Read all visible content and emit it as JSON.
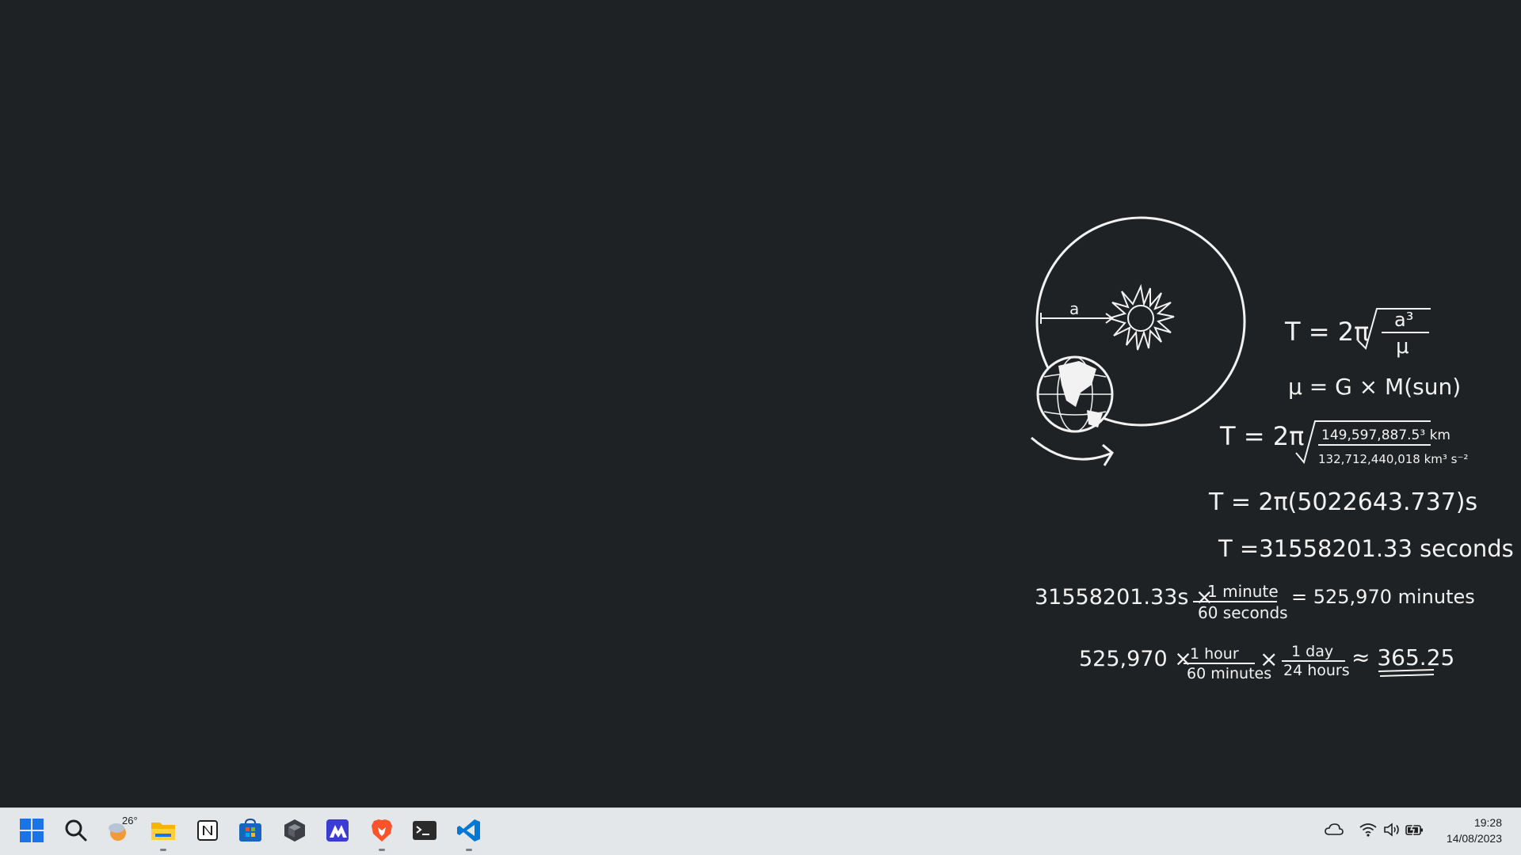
{
  "wallpaper": {
    "diagram_label": "a",
    "equations": {
      "eq1_lhs": "T = 2π",
      "eq1_num": "a³",
      "eq1_den": "μ",
      "eq2": "μ = G × M(sun)",
      "eq3_lhs": "T = 2π",
      "eq3_num": "149,597,887.5³ km",
      "eq3_den": "132,712,440,018 km³ s⁻²",
      "eq4": "T = 2π(5022643.737)s",
      "eq5": "T =31558201.33 seconds",
      "eq6_lhs": "31558201.33s ×",
      "eq6_num": "1 minute",
      "eq6_den": "60 seconds",
      "eq6_rhs": "= 525,970 minutes",
      "eq7_lhs": "525,970 ×",
      "eq7_num1": "1 hour",
      "eq7_den1": "60 minutes",
      "eq7_mid": "×",
      "eq7_num2": "1 day",
      "eq7_den2": "24 hours",
      "eq7_rhs": "≈ 365.25"
    }
  },
  "taskbar": {
    "weather_temp": "26°",
    "apps": [
      "start",
      "search",
      "weather",
      "file-explorer",
      "notion",
      "microsoft-store",
      "unity",
      "affinity",
      "brave",
      "terminal",
      "vscode"
    ]
  },
  "clock": {
    "time": "19:28",
    "date": "14/08/2023"
  },
  "colors": {
    "desktop_bg": "#1f2224",
    "taskbar_bg": "#e3e7ea",
    "chalk": "#f2f2f2"
  }
}
